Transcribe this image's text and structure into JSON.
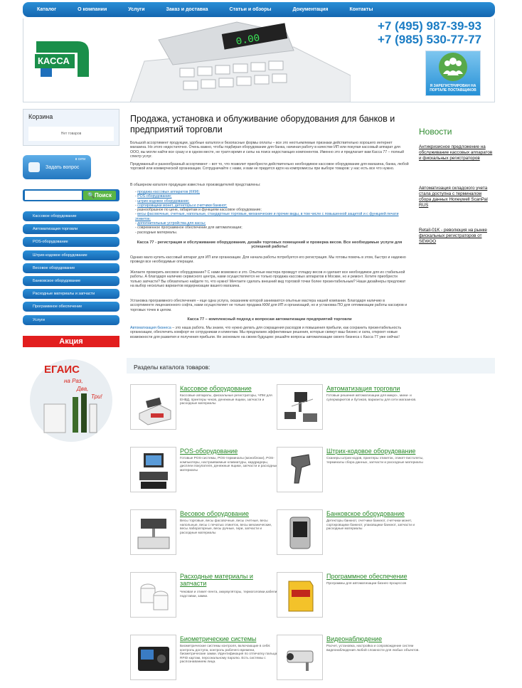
{
  "nav": [
    "Каталог",
    "О компании",
    "Услуги",
    "Заказ и доставка",
    "Статьи и обзоры",
    "Документация",
    "Контакты"
  ],
  "header": {
    "logo_text": "КАССА",
    "phone1": "+7 (495) 987-39-93",
    "phone2": "+7 (985) 530-77-77",
    "badge": "Я ЗАРЕГИСТРИРОВАН НА ПОРТАЛЕ ПОСТАВЩИКОВ"
  },
  "cart": {
    "title": "Корзина",
    "empty": "Нет товаров"
  },
  "ask": {
    "status": "в сети",
    "label": "Задать вопрос"
  },
  "search": {
    "placeholder": "",
    "button": "Поиск"
  },
  "menu": [
    "Кассовое оборудование",
    "Автоматизация торговли",
    "POS-оборудование",
    "Штрих-кодовое оборудование",
    "Весовое оборудование",
    "Банковское оборудование",
    "Расходные материалы и запчасти",
    "Программное обеспечение",
    "Услуги"
  ],
  "akcia": "Акция",
  "egais": {
    "title": "ЕГАИС",
    "sub1": "на Раз,",
    "sub2": "Два,",
    "sub3": "Три!"
  },
  "main": {
    "title": "Продажа, установка и облуживание оборудования для банков и предприятий торговли",
    "p1": "Большой ассортимент продукции, удобные каталоги и безопасные формы оплаты – все это неотъемлемые признаки действительно хорошего интернет магазина. Но этого недостаточно. Очень важно, чтобы подбирая оборудование для банка, начиная работу в качестве ИП или покупая кассовый аппарат для ООО, вы могли найти все сразу и в одном месте, не тратя время и силы на поиск недостающих компонентов. Именно это и предлагает вам Касса 77 – полный спектр услуг.",
    "p2": "Продуманный и разнообразный ассортимент – вот то, что позволит приобрести действительно необходимое кассовое оборудование для магазина, банка, любой торговой или коммерческой организации. Сотрудничайте с нами, и вам не придется идти на компромиссы при выборе товаров: у нас есть все что нужно.",
    "p3": "В обширном каталоге продукции известных производителей представлены:",
    "list": [
      "продажа кассовых аппаратов (ККМ);",
      "POS-оборудование;",
      "штрих-кодовое оборудование;",
      "сортировщики монет, детекторы и счетчики банкнот;",
      "разнообразное по цене, габаритам и функциям кассовое оборудование;",
      "весы фасовочные, счетные, напольные, стандартные торговые, механические и прочие виды, в том числе с повышенной защитой и с функцией печати этикеток;",
      "дополнительные устройства для кассы;",
      "современное программное обеспечение для автоматизации;",
      "расходные материалы."
    ],
    "bold1": "Касса 77 - регистрация и обслуживание оборудования, дизайн торговых помещений и проверка весов. Все необходимые услуги для успешной работы!",
    "p4": "Однако мало купить кассовый аппарат для ИП или организации. Для начала работы потребуется его регистрация. Мы готовы помочь в этом, быстро и надежно проведя все необходимые операции.",
    "p5": "Желаете проверить весовое оборудование? С нами возможно и это. Опытные мастера проведут отладку весов и сделают все необходимое для их стабильной работы. А благодаря наличию сервисного центра, нами осуществляется не только продажа кассовых аппаратов в Москве, но и ремонт. Хотите приобрести только запчасти? Вы обязательно найдете то, что нужно! Мечтаете сделать внешний вид торговой точки более презентабельным? Наши дизайнеры предложат на выбор несколько вариантов модернизации вашего магазина.",
    "p6": "Установка программного обеспечения – еще одна услуга, оказанием которой занимаются опытные мастера нашей компании. Благодаря наличию в ассортименте лицензионного софта, нами осуществляет не только продажа ККМ для ИП и организаций, но и установка ПО для оптимизации работы кассиров и торговых точек в целом.",
    "bold2": "Касса 77 – комплексный подход к вопросам автоматизации предприятий торговли",
    "p7_link": "Автоматизация бизнеса",
    "p7": " – это наша работа. Мы знаем, что нужно делать для сокращения расходов и повышения прибыли, как сохранить презентабельность организации, обеспечить комфорт ее сотрудникам и клиентам. Мы предлагаем эффективные решения, которые свяжут ваш бизнес и сила, откроют новые возможности для развития и получения прибыли. Не экономьте на своем будущем: решайте вопросы автоматизации своего бизнеса с Касса 77 уже сейчас!"
  },
  "news": {
    "title": "Новости",
    "items": [
      "Антикризисное предложение на обслуживание кассовых аппаратов и фискальных регистраторов",
      "Автоматизация складского учета стала доступна с терминалом сбора данных Honeywell ScanPal RUS",
      "Retail-01K - революция на рынке фискальных регистраторов от SEWOO"
    ]
  },
  "catalog": {
    "title": "Разделы каталога товаров:",
    "items": [
      {
        "title": "Кассовое оборудование",
        "desc": "Кассовые аппараты, фискальные регистраторы, ЧПМ для ЕНВД, принтеры чеков, денежные ящики, запчасти и расходные материалы"
      },
      {
        "title": "Автоматизация торговли",
        "desc": "Готовые решения автоматизации для микро-, мини- и супермаркетов и бутиков, варианты для сети магазинов."
      },
      {
        "title": "POS-оборудование",
        "desc": "Готовые POS-системы, POS-терминалы (моноблоки), POS-компьютеры, настраиваемые клавиатуры, кардридеры, дисплеи покупателя, денежные ящики, запчасти и расходные материалы"
      },
      {
        "title": "Штрих-кодовое оборудование",
        "desc": "Сканеры штрих-кодов, принтеры этикеток, этикет-пистолеты, терминалы сбора данных, запчасти и расходные материалы"
      },
      {
        "title": "Весовое оборудование",
        "desc": "Весы торговые, весы фасовочные, весы счетные, весы напольные, весы с печатью этикеток, весы механические, весы лабораторные, весы ручные, гири, запчасти и расходные материалы"
      },
      {
        "title": "Банковское оборудование",
        "desc": "Детекторы банкнот, счетчики банкнот, счетчики монет, сортировщики банкнот, упаковщики банкнот, запчасти и расходные материалы"
      },
      {
        "title": "Расходные материалы и запчасти",
        "desc": "Чековая и этикет-лента, аккумуляторы, термоголовки,кабели, подставки, замки."
      },
      {
        "title": "Программное обеспечение",
        "desc": "Программы для автоматизации бизнес-процессов"
      },
      {
        "title": "Биометрические системы",
        "desc": "Биометрические системы контроля, включающие в себя: контроль доступа, контроль рабочего времени, биометрические замки. Идентификация по отпечатку пальца, RFID картам, персональному паролю. Есть системы с распознаванием лица."
      },
      {
        "title": "Видеонаблюдение",
        "desc": "Расчет, установка, настройка и сопровождение систем видеонаблюдения любой сложности для любых объектов."
      }
    ]
  }
}
